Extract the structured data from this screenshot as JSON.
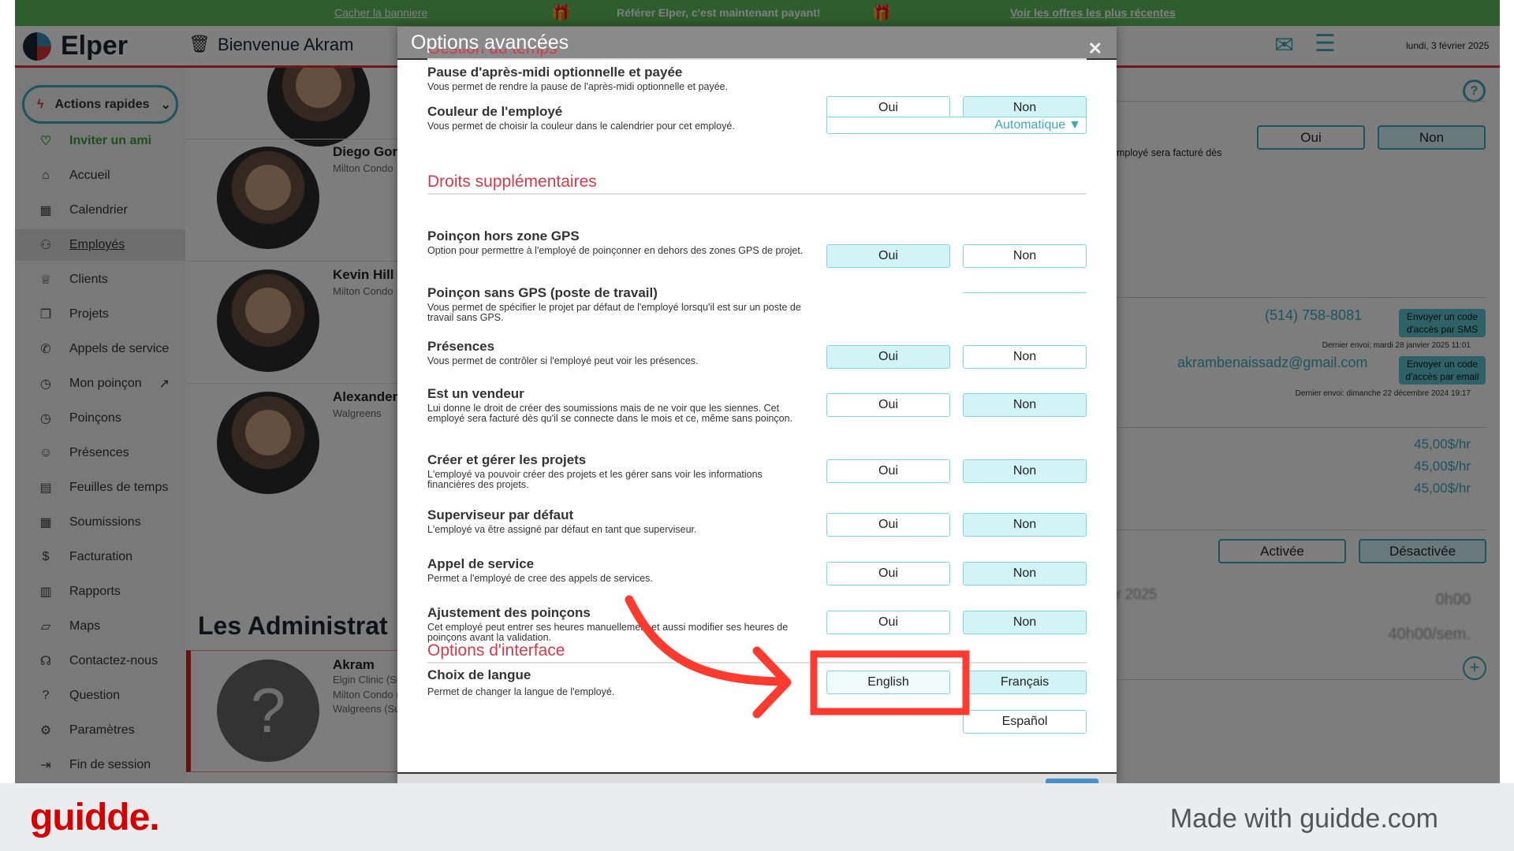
{
  "banner": {
    "hide": "Cacher la banniere",
    "promo": "Référer Elper, c'est maintenant payant!",
    "offers": "Voir les offres les plus récentes"
  },
  "header": {
    "logo": "Elper",
    "welcome": "Bienvenue Akram",
    "date": "lundi, 3 février 2025"
  },
  "sidebar": {
    "quick_actions": "Actions rapides",
    "invite": "Inviter un ami",
    "items": [
      {
        "label": "Accueil",
        "icon": "home-icon"
      },
      {
        "label": "Calendrier",
        "icon": "calendar-icon"
      },
      {
        "label": "Employés",
        "icon": "users-icon",
        "active": true
      },
      {
        "label": "Clients",
        "icon": "crown-icon"
      },
      {
        "label": "Projets",
        "icon": "folder-icon"
      },
      {
        "label": "Appels de service",
        "icon": "phone-icon"
      },
      {
        "label": "Mon poinçon",
        "icon": "clock-icon"
      },
      {
        "label": "Poinçons",
        "icon": "clock-icon"
      },
      {
        "label": "Présences",
        "icon": "user-check-icon"
      },
      {
        "label": "Feuilles de temps",
        "icon": "timesheet-icon"
      },
      {
        "label": "Soumissions",
        "icon": "calculator-icon"
      },
      {
        "label": "Facturation",
        "icon": "invoice-icon"
      },
      {
        "label": "Rapports",
        "icon": "report-icon"
      },
      {
        "label": "Maps",
        "icon": "map-icon"
      },
      {
        "label": "Contactez-nous",
        "icon": "headset-icon"
      },
      {
        "label": "Question",
        "icon": "question-icon"
      },
      {
        "label": "Paramètres",
        "icon": "gear-icon"
      },
      {
        "label": "Fin de session",
        "icon": "logout-icon"
      }
    ]
  },
  "employees": [
    {
      "name": "Diego Gor",
      "company": "Milton Condo"
    },
    {
      "name": "Kevin Hill",
      "company": "Milton Condo"
    },
    {
      "name": "Alexander",
      "company": "Walgreens"
    }
  ],
  "admins": {
    "title": "Les Administrat",
    "card": {
      "name": "Akram",
      "lines": [
        "Elgin Clinic (Su",
        "Milton Condo (",
        "Walgreens (Su"
      ]
    }
  },
  "detail": {
    "oui": "Oui",
    "non": "Non",
    "billed_text": "mployé sera facturé dès",
    "phone": "(514) 758-8081",
    "sms_btn": "Envoyer un code d'accès par SMS",
    "sms_last": "Dernier envoi: mardi 28 janvier 2025 11:01",
    "email": "akrambenaissadz@gmail.com",
    "email_btn": "Envoyer un code d'accès par email",
    "email_last": "Dernier envoi: dimanche 22 décembre 2024 19:17",
    "rates": [
      "45,00$/hr",
      "45,00$/hr",
      "45,00$/hr"
    ],
    "activated": "Activée",
    "deactivated": "Désactivée",
    "date_partial": "r 2025",
    "hours": "0h00",
    "weekly": "40h00/sem."
  },
  "modal": {
    "title": "Options avancées",
    "partial_section": "Gestion du temps",
    "sections": {
      "rights": "Droits supplémentaires",
      "interface": "Options d'interface"
    },
    "yes": "Oui",
    "no": "Non",
    "options": [
      {
        "title": "Pause d'après-midi optionnelle et payée",
        "desc": "Vous permet de rendre la pause de l'après-midi optionnelle et payée.",
        "value": "Non"
      },
      {
        "title": "Couleur de l'employé",
        "desc": "Vous permet de choisir la couleur dans le calendrier pour cet employé.",
        "select": "Automatique"
      },
      {
        "title": "Poinçon hors zone GPS",
        "desc": "Option pour permettre à l'employé de poinçonner en dehors des zones GPS de projet.",
        "value": "Oui"
      },
      {
        "title": "Poinçon sans GPS (poste de travail)",
        "desc": "Vous permet de spécifier le projet par défaut de l'employé lorsqu'il est sur un poste de travail sans GPS."
      },
      {
        "title": "Présences",
        "desc": "Vous permet de contrôler si l'employé peut voir les présences.",
        "value": "Oui"
      },
      {
        "title": "Est un vendeur",
        "desc": "Lui donne le droit de créer des soumissions mais de ne voir que les siennes. Cet employé sera facturé dès qu'il se connecte dans le mois et ce, même sans poinçon.",
        "value": "Non"
      },
      {
        "title": "Créer et gérer les projets",
        "desc": "L'employé va pouvoir créer des projets et les gérer sans voir les informations financières des projets.",
        "value": "Non"
      },
      {
        "title": "Superviseur par défaut",
        "desc": "L'employé va être assigné par défaut en tant que superviseur.",
        "value": "Non"
      },
      {
        "title": "Appel de service",
        "desc": "Permet a l'employé de cree des appels de services.",
        "value": "Non"
      },
      {
        "title": "Ajustement des poinçons",
        "desc": "Cet employé peut entrer ses heures manuellement et aussi modifier ses heures de poinçons avant la validation.",
        "value": "Non"
      }
    ],
    "language": {
      "title": "Choix de langue",
      "desc": "Permet de changer la langue de l'employé.",
      "options": [
        "English",
        "Français",
        "Español"
      ],
      "selected": "Français"
    }
  },
  "annotation": {
    "color": "#ff3b30",
    "highlight": "English"
  },
  "footer": {
    "brand": "guidde.",
    "made_with": "Made with guidde.com"
  },
  "colors": {
    "accent": "#3aa9bd",
    "section": "#d33b4a",
    "banner": "#5cba5c",
    "selected_bg": "#d3f4f7"
  }
}
